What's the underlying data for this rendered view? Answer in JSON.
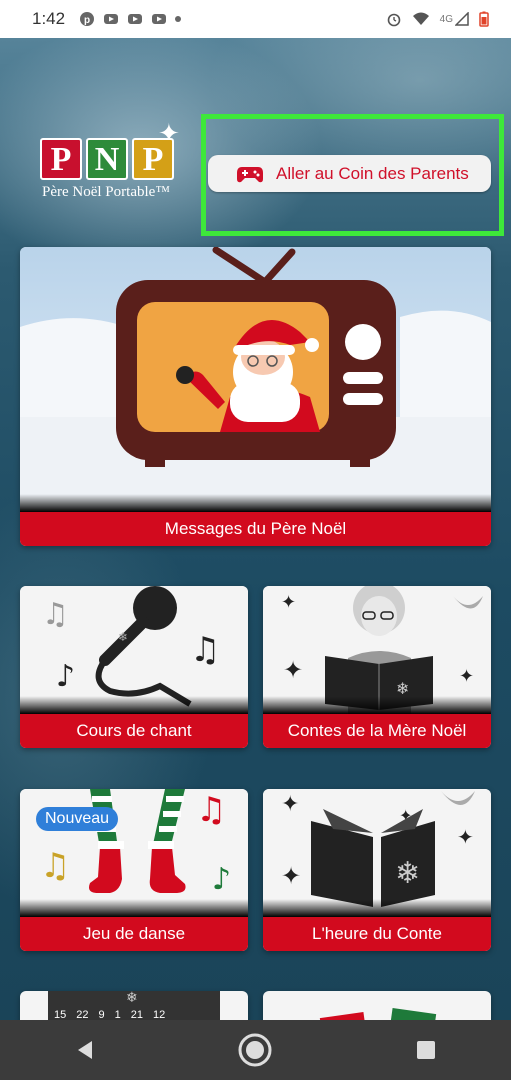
{
  "status_bar": {
    "time": "1:42",
    "network": "4G",
    "icons": [
      "pinterest-icon",
      "youtube-icon",
      "youtube-icon",
      "youtube-icon",
      "dot-icon",
      "alarm-icon",
      "wifi-icon",
      "signal-icon",
      "battery-icon"
    ]
  },
  "logo": {
    "letters": [
      "P",
      "N",
      "P"
    ],
    "subtitle": "Père Noël Portable™"
  },
  "parent_button": {
    "label": "Aller au Coin des Parents",
    "icon": "gamepad-icon"
  },
  "cards": {
    "messages": {
      "label": "Messages du Père Noël"
    },
    "chant": {
      "label": "Cours de chant"
    },
    "contes": {
      "label": "Contes de la Mère Noël"
    },
    "danse": {
      "label": "Jeu de danse",
      "badge": "Nouveau"
    },
    "heure": {
      "label": "L'heure du Conte"
    }
  },
  "calendar_numbers": [
    "15",
    "22",
    "9",
    "1",
    "21",
    "12"
  ],
  "colors": {
    "accent_red": "#d20a1e",
    "highlight_green": "#3ee83a",
    "badge_blue": "#2f7fd9"
  },
  "nav": [
    "back-icon",
    "home-icon",
    "recents-icon"
  ]
}
